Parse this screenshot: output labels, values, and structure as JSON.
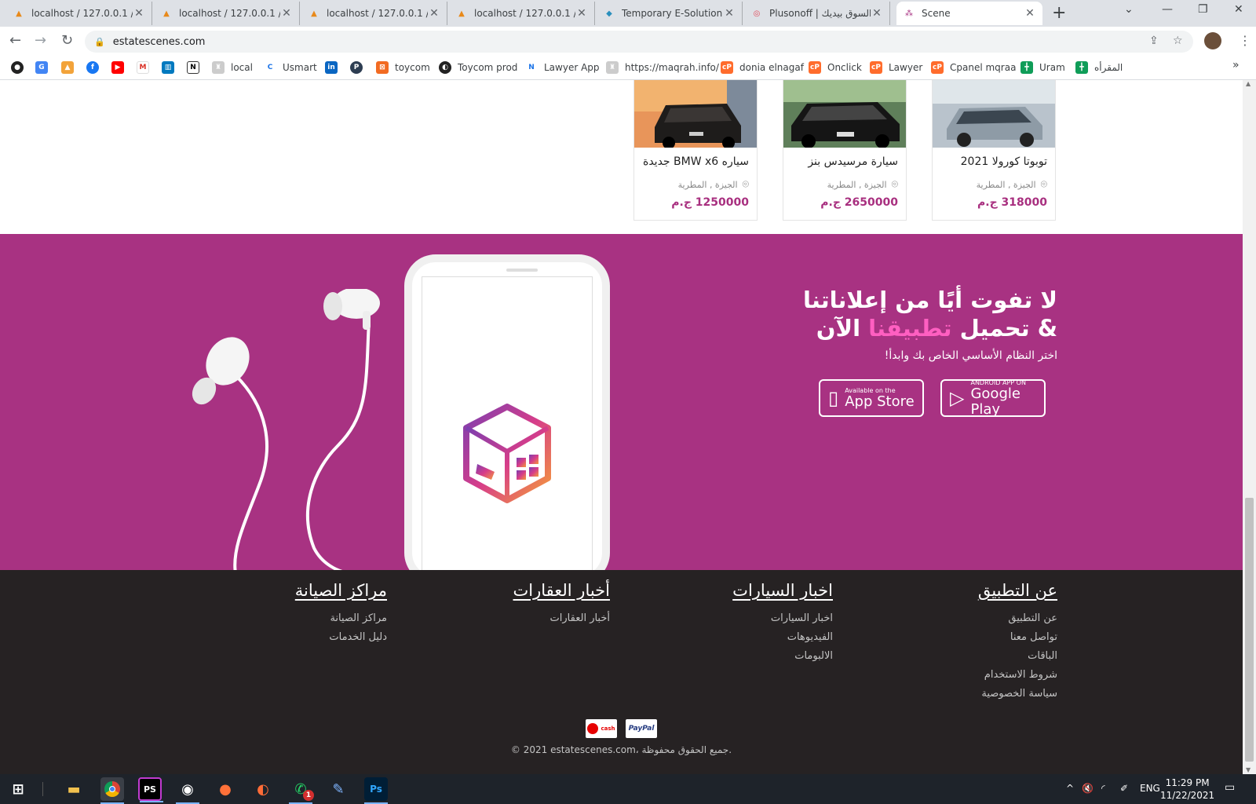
{
  "browser": {
    "tabs": [
      {
        "title": "localhost / 127.0.0.1 / u",
        "icon": "pma-icon"
      },
      {
        "title": "localhost / 127.0.0.1 / u",
        "icon": "pma-icon"
      },
      {
        "title": "localhost / 127.0.0.1 / u",
        "icon": "pma-icon"
      },
      {
        "title": "localhost / 127.0.0.1 / u",
        "icon": "pma-icon"
      },
      {
        "title": "Temporary E-Solution",
        "icon": "tes-icon"
      },
      {
        "title": "Plusonoff | السوق بيديك",
        "icon": "plusonoff-icon"
      },
      {
        "title": "Scene",
        "icon": "scene-icon",
        "active": true
      }
    ],
    "url": "estatescenes.com",
    "bookmarks": [
      {
        "label": "",
        "icon": "github-icon"
      },
      {
        "label": "",
        "icon": "translate-icon"
      },
      {
        "label": "",
        "icon": "pma-icon"
      },
      {
        "label": "",
        "icon": "facebook-icon"
      },
      {
        "label": "",
        "icon": "youtube-icon"
      },
      {
        "label": "",
        "icon": "gmail-icon"
      },
      {
        "label": "",
        "icon": "trello-icon"
      },
      {
        "label": "",
        "icon": "notion-icon"
      },
      {
        "label": "local",
        "icon": "local-icon"
      },
      {
        "label": "Usmart",
        "icon": "usmart-icon"
      },
      {
        "label": "",
        "icon": "linkedin-icon"
      },
      {
        "label": "",
        "icon": "p-icon"
      },
      {
        "label": "toycom",
        "icon": "toycom-icon"
      },
      {
        "label": "Toycom prod",
        "icon": "toycom-prod-icon"
      },
      {
        "label": "Lawyer App",
        "icon": "lawyer-app-icon"
      },
      {
        "label": "https://maqrah.info/",
        "icon": "maqrah-icon"
      },
      {
        "label": "donia elnagaf",
        "icon": "cpanel-icon"
      },
      {
        "label": "Onclick",
        "icon": "cpanel-icon"
      },
      {
        "label": "Lawyer",
        "icon": "cpanel-icon"
      },
      {
        "label": "Cpanel mqraa",
        "icon": "cpanel-icon"
      },
      {
        "label": "Uram",
        "icon": "sheets-icon"
      },
      {
        "label": "المقرأه",
        "icon": "sheets-icon"
      }
    ]
  },
  "listings": [
    {
      "title": "توبوتا كورولا 2021",
      "location": "الجيزة , المطرية",
      "price": "318000 ج.م"
    },
    {
      "title": "سيارة مرسيدس بنز",
      "location": "الجيزة , المطرية",
      "price": "2650000 ج.م"
    },
    {
      "title": "سياره BMW x6 جديدة",
      "location": "الجيزة , المطرية",
      "price": "1250000 ج.م"
    }
  ],
  "promo": {
    "line1": "لا تفوت أيًا من إعلاناتنا",
    "line2_a": "& تحميل ",
    "line2_highlight": "تطبيقنا",
    "line2_b": " الآن",
    "subtitle": "اختر النظام الأساسي الخاص بك وابدأ!",
    "google_small": "ANDROID APP ON",
    "google_big": "Google Play",
    "apple_small": "Available on the",
    "apple_big": "App Store",
    "accent": "#a83282",
    "highlight": "#ff5fc1"
  },
  "footer": {
    "columns": [
      {
        "heading": "عن التطبيق",
        "links": [
          "عن التطبيق",
          "تواصل معنا",
          "الباقات",
          "شروط الاستخدام",
          "سياسة الخصوصية"
        ]
      },
      {
        "heading": "اخبار السيارات",
        "links": [
          "اخبار السيارات",
          "الفيديوهات",
          "الالبومات"
        ]
      },
      {
        "heading": "أخبار العقارات",
        "links": [
          "أخبار العقارات"
        ]
      },
      {
        "heading": "مراكز الصيانة",
        "links": [
          "مراكز الصيانة",
          "دليل الخدمات"
        ]
      }
    ],
    "payments": [
      "PayPal",
      "cash"
    ],
    "copyright": "© 2021 estatescenes.com، جميع الحقوق محفوظة."
  },
  "taskbar": {
    "apps": [
      "file-explorer-icon",
      "chrome-icon",
      "phpstorm-icon",
      "github-desktop-icon",
      "firefox-icon",
      "postman-icon",
      "whatsapp-icon",
      "paint-icon",
      "photoshop-icon"
    ],
    "whatsapp_badge": "1",
    "language": "ENG",
    "time": "11:29 PM",
    "date": "11/22/2021"
  }
}
